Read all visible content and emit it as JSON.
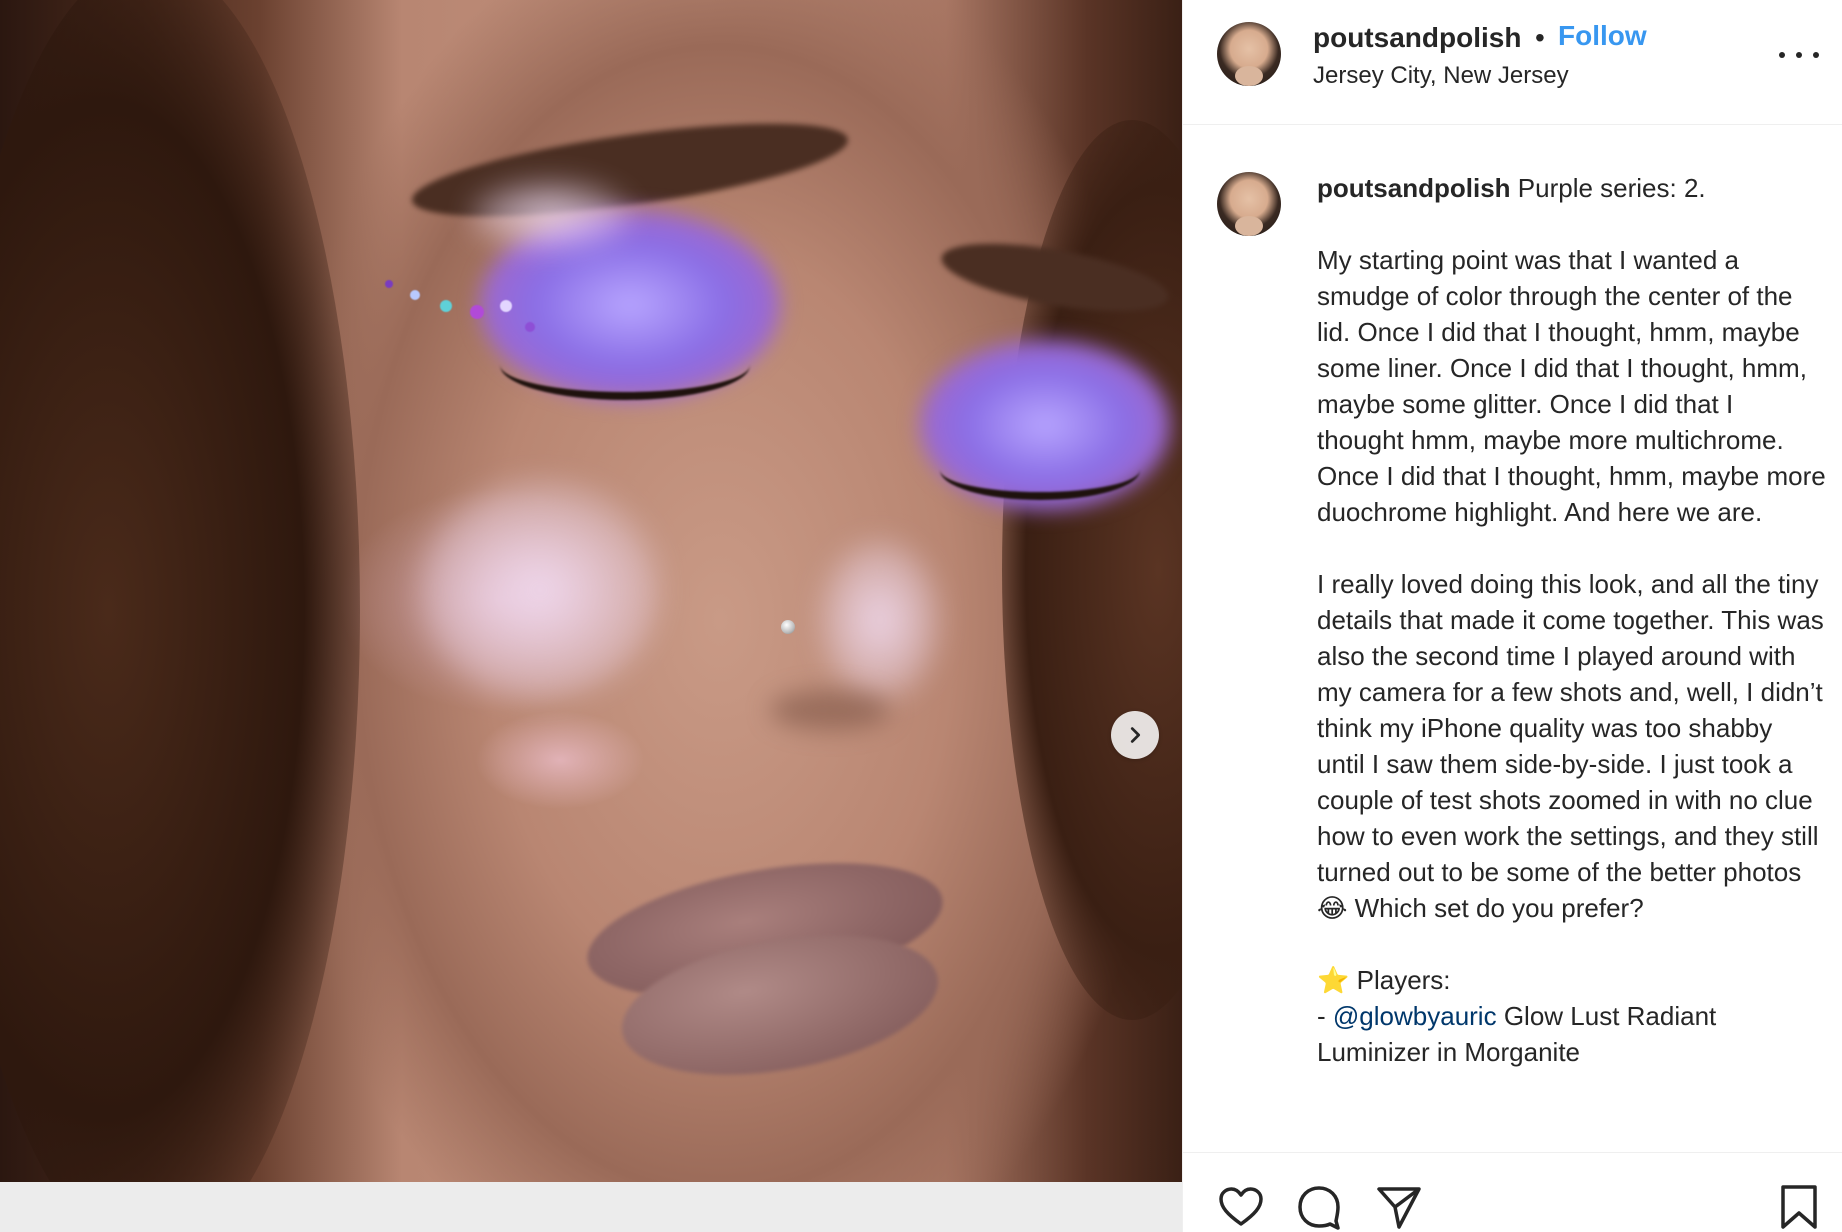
{
  "post": {
    "image_description_alt": "",
    "next_button_icon": "chevron-right-icon"
  },
  "header": {
    "username": "poutsandpolish",
    "separator": "•",
    "follow_label": "Follow",
    "location": "Jersey City, New Jersey",
    "more_icon": "more-options-icon"
  },
  "caption": {
    "author": "poutsandpolish",
    "title": "Purple series: 2.",
    "paragraph1": "My starting point was that I wanted a smudge of color through the center of the lid. Once I did that I thought, hmm, maybe some liner. Once I did that I thought, hmm, maybe some glitter. Once I did that I thought hmm, maybe more multichrome. Once I did that I thought, hmm, maybe more duochrome highlight. And here we are.",
    "paragraph2_before_emoji": "I really loved doing this look, and all the tiny details that made it come together. This was also the second time I played around with my camera for a few shots and, well, I didn’t think my iPhone quality was too shabby until I saw them side-by-side. I just took a couple of test shots zoomed in with no clue how to even work the settings, and they still turned out to be some of the better photos",
    "emoji_laugh": "😂",
    "paragraph2_after_emoji": "Which set do you prefer?",
    "emoji_star": "⭐️",
    "players_label": "Players:",
    "players_dash": "-",
    "mention1": "@glowbyauric",
    "product1": "Glow Lust Radiant Luminizer in Morganite"
  },
  "actions": {
    "like_icon": "heart-icon",
    "comment_icon": "comment-icon",
    "share_icon": "share-icon",
    "save_icon": "bookmark-icon"
  },
  "colors": {
    "follow": "#3897f0",
    "mention": "#00376b",
    "text": "#262626"
  }
}
